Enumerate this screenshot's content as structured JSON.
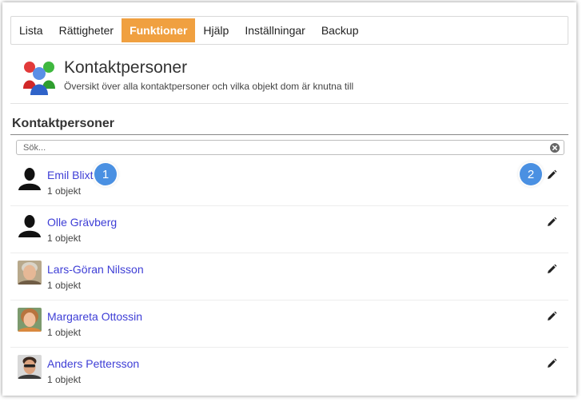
{
  "nav": {
    "items": [
      {
        "label": "Lista",
        "active": false
      },
      {
        "label": "Rättigheter",
        "active": false
      },
      {
        "label": "Funktioner",
        "active": true
      },
      {
        "label": "Hjälp",
        "active": false
      },
      {
        "label": "Inställningar",
        "active": false
      },
      {
        "label": "Backup",
        "active": false
      }
    ]
  },
  "header": {
    "title": "Kontaktpersoner",
    "subtitle": "Översikt över alla kontaktpersoner och vilka objekt dom är knutna till",
    "icon": "people-group-icon"
  },
  "section": {
    "title": "Kontaktpersoner"
  },
  "search": {
    "placeholder": "Sök...",
    "value": ""
  },
  "contacts": [
    {
      "name": "Emil Blixt",
      "count": "1 objekt",
      "avatar": "silhouette"
    },
    {
      "name": "Olle Grävberg",
      "count": "1 objekt",
      "avatar": "silhouette"
    },
    {
      "name": "Lars-Göran Nilsson",
      "count": "1 objekt",
      "avatar": "photo-man-gray"
    },
    {
      "name": "Margareta Ottossin",
      "count": "1 objekt",
      "avatar": "photo-woman"
    },
    {
      "name": "Anders Pettersson",
      "count": "1 objekt",
      "avatar": "photo-man-glasses"
    }
  ],
  "callouts": [
    {
      "label": "1"
    },
    {
      "label": "2"
    }
  ],
  "colors": {
    "accent": "#f0a040",
    "link": "#3e3ed6",
    "callout": "#4a90e2"
  }
}
